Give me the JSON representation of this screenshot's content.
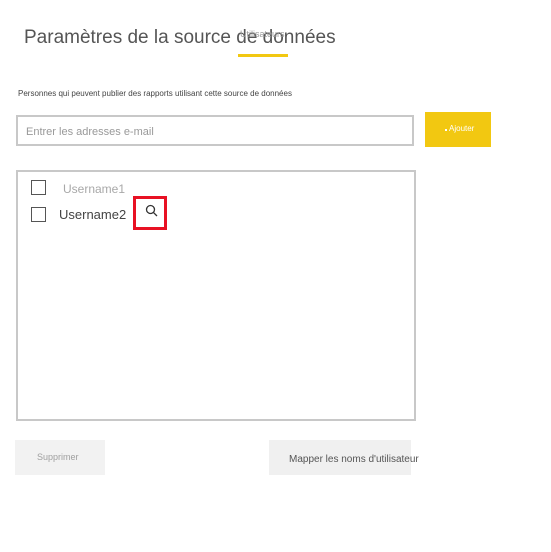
{
  "header": {
    "title": "Paramètres de la source de données",
    "tab_label": "Utilisateurs",
    "accent_color": "#f2c811"
  },
  "publish": {
    "description": "Personnes qui peuvent publier des rapports utilisant cette source de données",
    "email_placeholder": "Entrer les adresses e-mail",
    "add_label": "Ajouter"
  },
  "users": [
    {
      "name": "Username1",
      "checked": false
    },
    {
      "name": "Username2",
      "checked": false,
      "action_icon": "search-icon",
      "highlighted": true
    }
  ],
  "footer": {
    "delete_label": "Supprimer",
    "map_label": "Mapper les noms d'utilisateur"
  },
  "colors": {
    "highlight": "#e81123",
    "border": "#c8c8c8"
  }
}
